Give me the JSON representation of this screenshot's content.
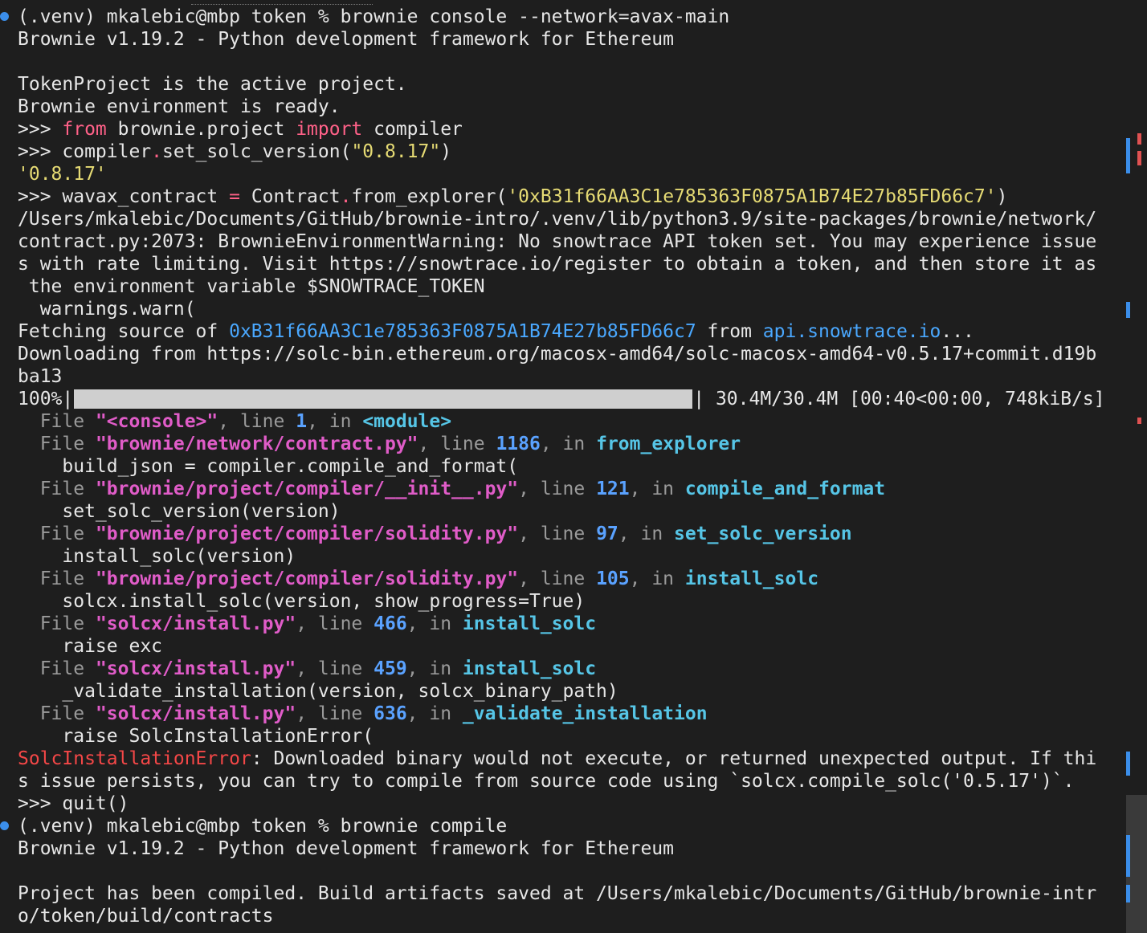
{
  "terminal": {
    "lines": [
      [
        {
          "t": "(.venv) mkalebic@mbp token % brownie console --network=avax-main",
          "c": "w"
        }
      ],
      [
        {
          "t": "Brownie v1.19.2 - Python development framework for Ethereum",
          "c": "w"
        }
      ],
      [
        {
          "t": "",
          "c": "w"
        }
      ],
      [
        {
          "t": "TokenProject is the active project.",
          "c": "w"
        }
      ],
      [
        {
          "t": "Brownie environment is ready.",
          "c": "w"
        }
      ],
      [
        {
          "t": ">>> ",
          "c": "w"
        },
        {
          "t": "from",
          "c": "kw"
        },
        {
          "t": " brownie.project ",
          "c": "w"
        },
        {
          "t": "import",
          "c": "kw"
        },
        {
          "t": " compiler",
          "c": "w"
        }
      ],
      [
        {
          "t": ">>> compiler",
          "c": "w"
        },
        {
          "t": ".",
          "c": "op"
        },
        {
          "t": "set_solc_version(",
          "c": "w"
        },
        {
          "t": "\"0.8.17\"",
          "c": "str"
        },
        {
          "t": ")",
          "c": "w"
        }
      ],
      [
        {
          "t": "'0.8.17'",
          "c": "str"
        }
      ],
      [
        {
          "t": ">>> wavax_contract ",
          "c": "w"
        },
        {
          "t": "=",
          "c": "op"
        },
        {
          "t": " Contract",
          "c": "w"
        },
        {
          "t": ".",
          "c": "op"
        },
        {
          "t": "from_explorer(",
          "c": "w"
        },
        {
          "t": "'0xB31f66AA3C1e785363F0875A1B74E27b85FD66c7'",
          "c": "str"
        },
        {
          "t": ")",
          "c": "w"
        }
      ],
      [
        {
          "t": "/Users/mkalebic/Documents/GitHub/brownie-intro/.venv/lib/python3.9/site-packages/brownie/network/",
          "c": "w"
        }
      ],
      [
        {
          "t": "contract.py:2073: BrownieEnvironmentWarning: No snowtrace API token set. You may experience issue",
          "c": "w"
        }
      ],
      [
        {
          "t": "s with rate limiting. Visit https://snowtrace.io/register to obtain a token, and then store it as",
          "c": "w"
        }
      ],
      [
        {
          "t": " the environment variable $SNOWTRACE_TOKEN",
          "c": "w"
        }
      ],
      [
        {
          "t": "  warnings.warn(",
          "c": "w"
        }
      ],
      [
        {
          "t": "Fetching source of ",
          "c": "w"
        },
        {
          "t": "0xB31f66AA3C1e785363F0875A1B74E27b85FD66c7",
          "c": "lnk"
        },
        {
          "t": " from ",
          "c": "w"
        },
        {
          "t": "api.snowtrace.io",
          "c": "lnk"
        },
        {
          "t": "...",
          "c": "w"
        }
      ],
      [
        {
          "t": "Downloading from https://solc-bin.ethereum.org/macosx-amd64/solc-macosx-amd64-v0.5.17+commit.d19b",
          "c": "w"
        }
      ],
      [
        {
          "t": "ba13",
          "c": "w"
        }
      ],
      [
        {
          "t": "100%|",
          "c": "w"
        },
        {
          "t": "",
          "c": "bar"
        },
        {
          "t": "| 30.4M/30.4M [00:40<00:00, 748kiB/s]",
          "c": "w"
        }
      ],
      [
        {
          "t": "  File ",
          "c": "dim"
        },
        {
          "t": "\"<console>\"",
          "c": "tb-file"
        },
        {
          "t": ", line ",
          "c": "dim"
        },
        {
          "t": "1",
          "c": "tb-num"
        },
        {
          "t": ", in ",
          "c": "dim"
        },
        {
          "t": "<module>",
          "c": "tb-fn"
        }
      ],
      [
        {
          "t": "  File ",
          "c": "dim"
        },
        {
          "t": "\"brownie/network/contract.py\"",
          "c": "tb-file"
        },
        {
          "t": ", line ",
          "c": "dim"
        },
        {
          "t": "1186",
          "c": "tb-num"
        },
        {
          "t": ", in ",
          "c": "dim"
        },
        {
          "t": "from_explorer",
          "c": "tb-fn"
        }
      ],
      [
        {
          "t": "    build_json = compiler.compile_and_format(",
          "c": "w"
        }
      ],
      [
        {
          "t": "  File ",
          "c": "dim"
        },
        {
          "t": "\"brownie/project/compiler/__init__.py\"",
          "c": "tb-file"
        },
        {
          "t": ", line ",
          "c": "dim"
        },
        {
          "t": "121",
          "c": "tb-num"
        },
        {
          "t": ", in ",
          "c": "dim"
        },
        {
          "t": "compile_and_format",
          "c": "tb-fn"
        }
      ],
      [
        {
          "t": "    set_solc_version(version)",
          "c": "w"
        }
      ],
      [
        {
          "t": "  File ",
          "c": "dim"
        },
        {
          "t": "\"brownie/project/compiler/solidity.py\"",
          "c": "tb-file"
        },
        {
          "t": ", line ",
          "c": "dim"
        },
        {
          "t": "97",
          "c": "tb-num"
        },
        {
          "t": ", in ",
          "c": "dim"
        },
        {
          "t": "set_solc_version",
          "c": "tb-fn"
        }
      ],
      [
        {
          "t": "    install_solc(version)",
          "c": "w"
        }
      ],
      [
        {
          "t": "  File ",
          "c": "dim"
        },
        {
          "t": "\"brownie/project/compiler/solidity.py\"",
          "c": "tb-file"
        },
        {
          "t": ", line ",
          "c": "dim"
        },
        {
          "t": "105",
          "c": "tb-num"
        },
        {
          "t": ", in ",
          "c": "dim"
        },
        {
          "t": "install_solc",
          "c": "tb-fn"
        }
      ],
      [
        {
          "t": "    solcx.install_solc(version, show_progress=True)",
          "c": "w"
        }
      ],
      [
        {
          "t": "  File ",
          "c": "dim"
        },
        {
          "t": "\"solcx/install.py\"",
          "c": "tb-file"
        },
        {
          "t": ", line ",
          "c": "dim"
        },
        {
          "t": "466",
          "c": "tb-num"
        },
        {
          "t": ", in ",
          "c": "dim"
        },
        {
          "t": "install_solc",
          "c": "tb-fn"
        }
      ],
      [
        {
          "t": "    raise exc",
          "c": "w"
        }
      ],
      [
        {
          "t": "  File ",
          "c": "dim"
        },
        {
          "t": "\"solcx/install.py\"",
          "c": "tb-file"
        },
        {
          "t": ", line ",
          "c": "dim"
        },
        {
          "t": "459",
          "c": "tb-num"
        },
        {
          "t": ", in ",
          "c": "dim"
        },
        {
          "t": "install_solc",
          "c": "tb-fn"
        }
      ],
      [
        {
          "t": "    _validate_installation(version, solcx_binary_path)",
          "c": "w"
        }
      ],
      [
        {
          "t": "  File ",
          "c": "dim"
        },
        {
          "t": "\"solcx/install.py\"",
          "c": "tb-file"
        },
        {
          "t": ", line ",
          "c": "dim"
        },
        {
          "t": "636",
          "c": "tb-num"
        },
        {
          "t": ", in ",
          "c": "dim"
        },
        {
          "t": "_validate_installation",
          "c": "tb-fn"
        }
      ],
      [
        {
          "t": "    raise SolcInstallationError(",
          "c": "w"
        }
      ],
      [
        {
          "t": "SolcInstallationError",
          "c": "red"
        },
        {
          "t": ": Downloaded binary would not execute, or returned unexpected output. If thi",
          "c": "w"
        }
      ],
      [
        {
          "t": "s issue persists, you can try to compile from source code using `solcx.compile_solc('0.5.17')`.",
          "c": "w"
        }
      ],
      [
        {
          "t": ">>> quit()",
          "c": "w"
        }
      ],
      [
        {
          "t": "(.venv) mkalebic@mbp token % brownie compile",
          "c": "w"
        }
      ],
      [
        {
          "t": "Brownie v1.19.2 - Python development framework for Ethereum",
          "c": "w"
        }
      ],
      [
        {
          "t": "",
          "c": "w"
        }
      ],
      [
        {
          "t": "Project has been compiled. Build artifacts saved at /Users/mkalebic/Documents/GitHub/brownie-intr",
          "c": "w"
        }
      ],
      [
        {
          "t": "o/token/build/contracts",
          "c": "w"
        }
      ]
    ],
    "progress": {
      "percent": 100
    },
    "colors": {
      "background": "#1e1e1e",
      "prompt_dot": "#3b8eea",
      "marker_blue": "#3b8eea",
      "marker_red": "#e05252"
    }
  }
}
